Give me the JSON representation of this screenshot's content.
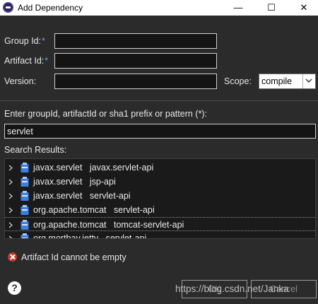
{
  "window": {
    "title": "Add Dependency",
    "minimize": "—",
    "maximize": "☐",
    "close": "✕"
  },
  "form": {
    "group_id_label": "Group Id:",
    "artifact_id_label": "Artifact Id:",
    "required_marker": "*",
    "version_label": "Version:",
    "scope_label": "Scope:",
    "scope_value": "compile",
    "group_id_value": "",
    "artifact_id_value": "",
    "version_value": ""
  },
  "search": {
    "prompt": "Enter groupId, artifactId or sha1 prefix or pattern (*):",
    "query": "servlet",
    "results_label": "Search Results:",
    "results": [
      {
        "group": "javax.servlet",
        "artifact": "javax.servlet-api"
      },
      {
        "group": "javax.servlet",
        "artifact": "jsp-api"
      },
      {
        "group": "javax.servlet",
        "artifact": "servlet-api"
      },
      {
        "group": "org.apache.tomcat",
        "artifact": "servlet-api"
      },
      {
        "group": "org.apache.tomcat",
        "artifact": "tomcat-servlet-api"
      },
      {
        "group": "org.mortbay.jetty",
        "artifact": "servlet-api"
      }
    ]
  },
  "status": {
    "error": "Artifact Id cannot be empty"
  },
  "buttons": {
    "ok": "OK",
    "cancel": "Cancel",
    "help": "?"
  },
  "watermark": "https://blog.csdn.net/Janka",
  "colors": {
    "background": "#2b2b2b",
    "required": "#5aa0ff",
    "error": "#c0392b"
  }
}
